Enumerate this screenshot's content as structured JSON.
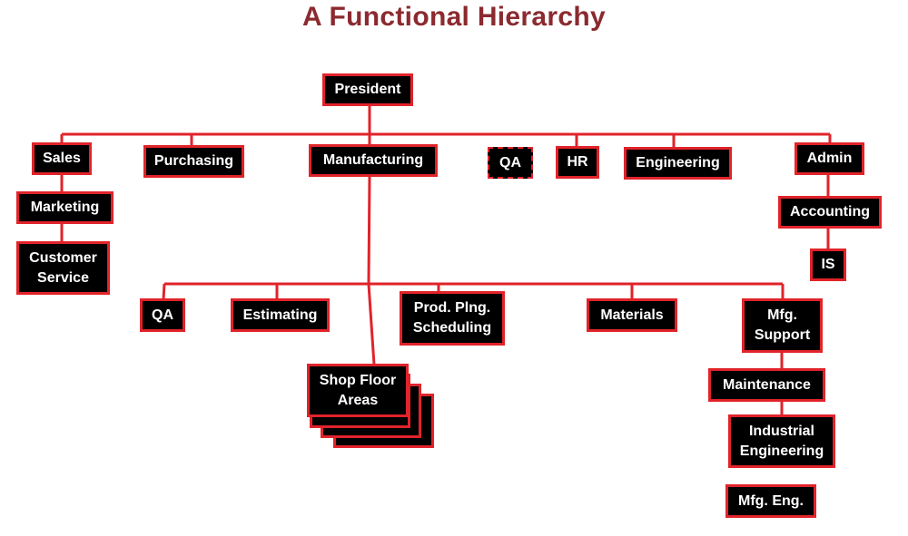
{
  "title": "A Functional Hierarchy",
  "colors": {
    "title": "#8b2a2f",
    "box_fill": "#000000",
    "box_border": "#e1232a",
    "connector": "#e1232a",
    "text": "#ffffff"
  },
  "nodes": {
    "president": "President",
    "sales": "Sales",
    "purchasing": "Purchasing",
    "manufacturing": "Manufacturing",
    "qa_top": "QA",
    "hr": "HR",
    "engineering": "Engineering",
    "admin": "Admin",
    "marketing": "Marketing",
    "customer_service": "Customer Service",
    "accounting": "Accounting",
    "is": "IS",
    "qa_mfg": "QA",
    "estimating": "Estimating",
    "prod_plng": "Prod. Plng. Scheduling",
    "materials": "Materials",
    "mfg_support": "Mfg. Support",
    "shop_floor": "Shop Floor Areas",
    "maintenance": "Maintenance",
    "industrial_eng": "Industrial Engineering",
    "mfg_eng": "Mfg. Eng."
  }
}
